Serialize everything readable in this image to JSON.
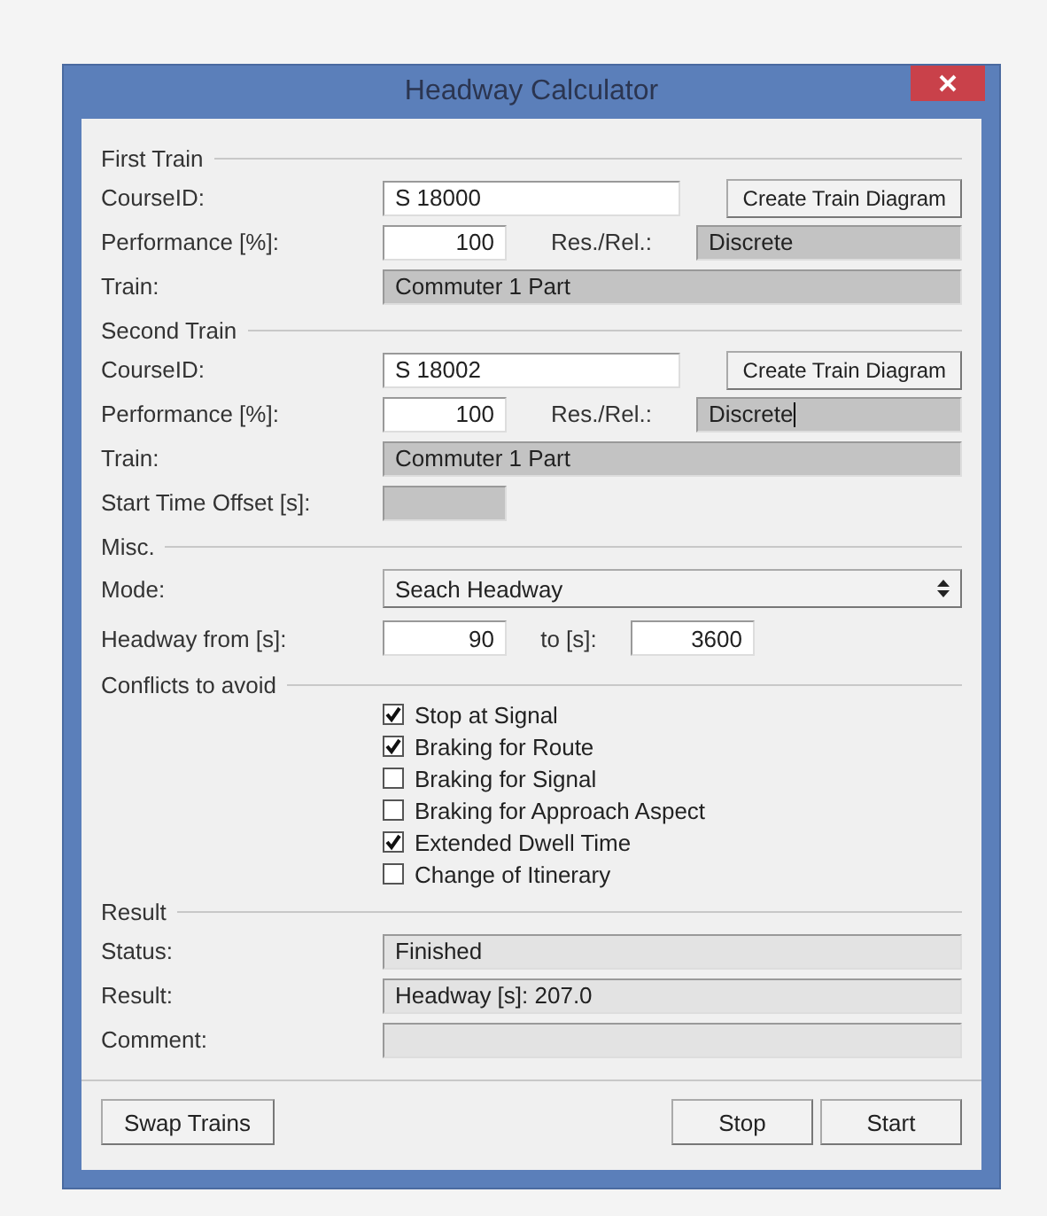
{
  "window": {
    "title": "Headway Calculator"
  },
  "sections": [
    {
      "title": "First Train",
      "rows": [
        {
          "kind": "course",
          "label": "CourseID:",
          "value": "S 18000",
          "button": "Create Train Diagram"
        },
        {
          "kind": "performance",
          "label": "Performance [%]:",
          "value": "100",
          "res_label": "Res./Rel.:",
          "res_value": "Discrete",
          "focused": false
        },
        {
          "kind": "readonly",
          "label": "Train:",
          "value": "Commuter 1 Part"
        }
      ]
    },
    {
      "title": "Second Train",
      "rows": [
        {
          "kind": "course",
          "label": "CourseID:",
          "value": "S 18002",
          "button": "Create Train Diagram"
        },
        {
          "kind": "performance",
          "label": "Performance [%]:",
          "value": "100",
          "res_label": "Res./Rel.:",
          "res_value": "Discrete",
          "focused": true
        },
        {
          "kind": "readonly",
          "label": "Train:",
          "value": "Commuter 1 Part"
        },
        {
          "kind": "short",
          "label": "Start Time Offset [s]:"
        }
      ]
    },
    {
      "title": "Misc.",
      "rows": [
        {
          "kind": "select",
          "label": "Mode:",
          "value": "Seach Headway"
        },
        {
          "kind": "range",
          "label": "Headway from [s]:",
          "value": "90",
          "to_label": "to [s]:",
          "to_value": "3600"
        }
      ]
    },
    {
      "title": "Conflicts to avoid",
      "rows": [
        {
          "kind": "checks",
          "items": [
            {
              "label": "Stop at Signal",
              "checked": true
            },
            {
              "label": "Braking for Route",
              "checked": true
            },
            {
              "label": "Braking for Signal",
              "checked": false
            },
            {
              "label": "Braking for Approach Aspect",
              "checked": false
            },
            {
              "label": "Extended Dwell Time",
              "checked": true
            },
            {
              "label": "Change of Itinerary",
              "checked": false
            }
          ]
        }
      ]
    },
    {
      "title": "Result",
      "rows": [
        {
          "kind": "result",
          "label": "Status:",
          "value": "Finished"
        },
        {
          "kind": "result",
          "label": "Result:",
          "value": "Headway [s]: 207.0"
        },
        {
          "kind": "result",
          "label": "Comment:"
        }
      ]
    }
  ],
  "footer": {
    "left": [
      "Swap Trains"
    ],
    "right": [
      "Stop",
      "Start"
    ]
  }
}
